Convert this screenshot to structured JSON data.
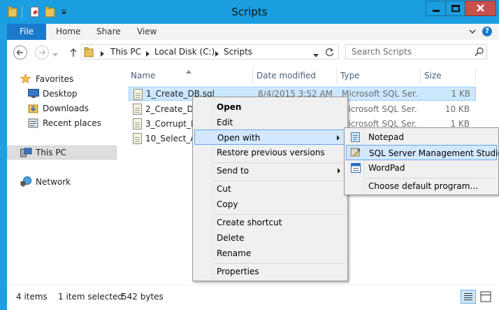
{
  "window": {
    "title": "Scripts",
    "min_label": "−",
    "max_label": "□",
    "close_label": "✕"
  },
  "ribbon": {
    "file": "File",
    "tabs": [
      "Home",
      "Share",
      "View"
    ],
    "help": "?"
  },
  "address": {
    "path": [
      "This PC",
      "Local Disk (C:)",
      "Scripts"
    ],
    "search_placeholder": "Search Scripts"
  },
  "nav": {
    "favorites": "Favorites",
    "desktop": "Desktop",
    "downloads": "Downloads",
    "recent": "Recent places",
    "thispc": "This PC",
    "network": "Network"
  },
  "columns": {
    "name": "Name",
    "date": "Date modified",
    "type": "Type",
    "size": "Size"
  },
  "files": [
    {
      "name": "1_Create_DB.sql",
      "date": "8/4/2015 3:52 AM",
      "type": "Microsoft SQL Ser...",
      "size": "1 KB"
    },
    {
      "name": "2_Create_Dat",
      "date": "",
      "type": "Microsoft SQL Ser...",
      "size": "10 KB"
    },
    {
      "name": "3_Corrupt_DI",
      "date": "",
      "type": "Microsoft SQL Ser...",
      "size": "1 KB"
    },
    {
      "name": "10_Select_All",
      "date": "",
      "type": "",
      "size": ""
    }
  ],
  "context_menu": {
    "open": "Open",
    "edit": "Edit",
    "open_with": "Open with",
    "restore": "Restore previous versions",
    "send_to": "Send to",
    "cut": "Cut",
    "copy": "Copy",
    "create_shortcut": "Create shortcut",
    "delete": "Delete",
    "rename": "Rename",
    "properties": "Properties"
  },
  "submenu": {
    "notepad": "Notepad",
    "ssms": "SQL Server Management Studio",
    "wordpad": "WordPad",
    "choose": "Choose default program..."
  },
  "status": {
    "items": "4 items",
    "selected": "1 item selected",
    "size": "542 bytes"
  },
  "colors": {
    "titlebar": "#1a9ee0",
    "file_tab": "#1979ca",
    "selection": "#cce8ff",
    "close_button": "#c7504b"
  }
}
